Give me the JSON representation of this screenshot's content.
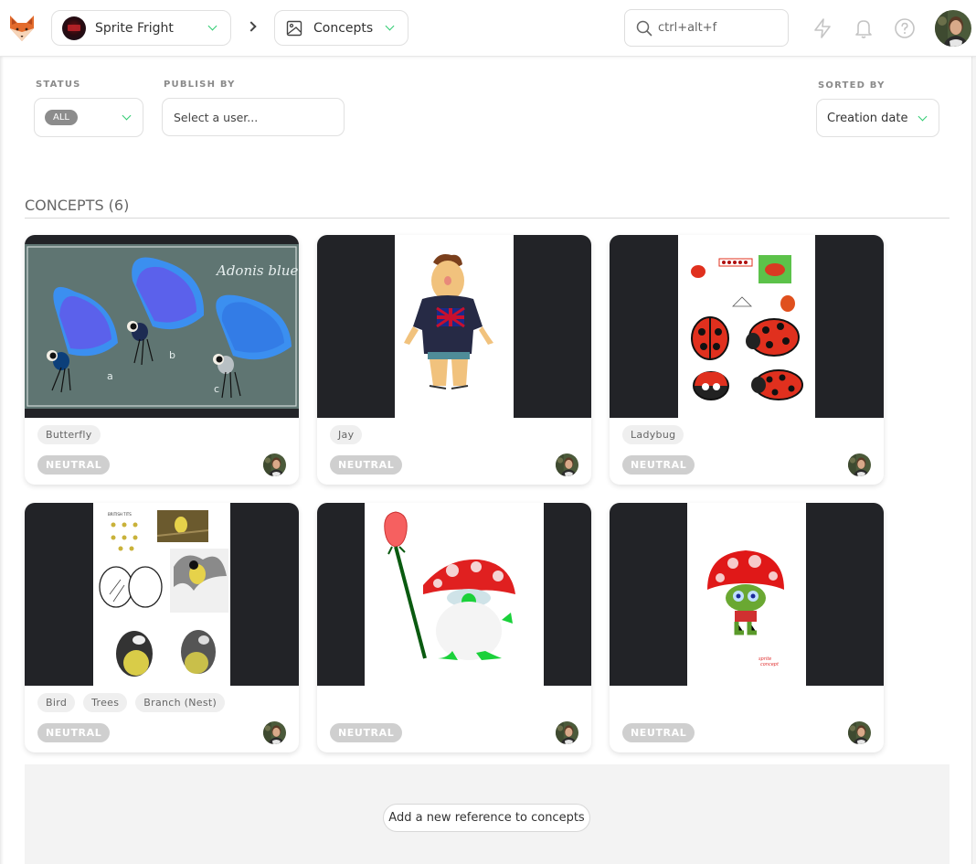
{
  "topbar": {
    "logo_icon": "kitsu-fox-logo",
    "production": {
      "name": "Sprite Fright",
      "thumbnail": "sprite-fright-poster"
    },
    "breadcrumb_separator_icon": "chevron-right-icon",
    "section": {
      "name": "Concepts",
      "icon": "image-icon"
    },
    "search": {
      "placeholder": "ctrl+alt+f",
      "value": "",
      "icon": "search-icon"
    },
    "icons": [
      "lightning-icon",
      "bell-icon",
      "help-circle-icon"
    ],
    "user_avatar": "user-avatar"
  },
  "filters": {
    "status": {
      "label": "STATUS",
      "selected": "ALL"
    },
    "publish_by": {
      "label": "PUBLISH BY",
      "placeholder": "Select a user...",
      "value": ""
    },
    "sorted_by": {
      "label": "SORTED BY",
      "selected": "Creation date"
    }
  },
  "section": {
    "title": "CONCEPTS (6)"
  },
  "concepts": [
    {
      "preview": "butterfly-concept",
      "preview_caption": "Adonis blue",
      "tags": [
        "Butterfly"
      ],
      "status": "NEUTRAL"
    },
    {
      "preview": "jay-character",
      "tags": [
        "Jay"
      ],
      "status": "NEUTRAL"
    },
    {
      "preview": "ladybug-sheet",
      "tags": [
        "Ladybug"
      ],
      "status": "NEUTRAL"
    },
    {
      "preview": "bird-sheet",
      "tags": [
        "Bird",
        "Trees",
        "Branch (Nest)"
      ],
      "status": "NEUTRAL"
    },
    {
      "preview": "mushroom-rose",
      "tags": [],
      "status": "NEUTRAL"
    },
    {
      "preview": "mushroom-green",
      "tags": [],
      "status": "NEUTRAL"
    }
  ],
  "add_reference": {
    "label": "Add a new reference to concepts"
  },
  "colors": {
    "accent_green": "#2ecc71",
    "card_dark": "#222327",
    "status_neutral": "#cfcfcf",
    "tag_bg": "#efefef"
  }
}
